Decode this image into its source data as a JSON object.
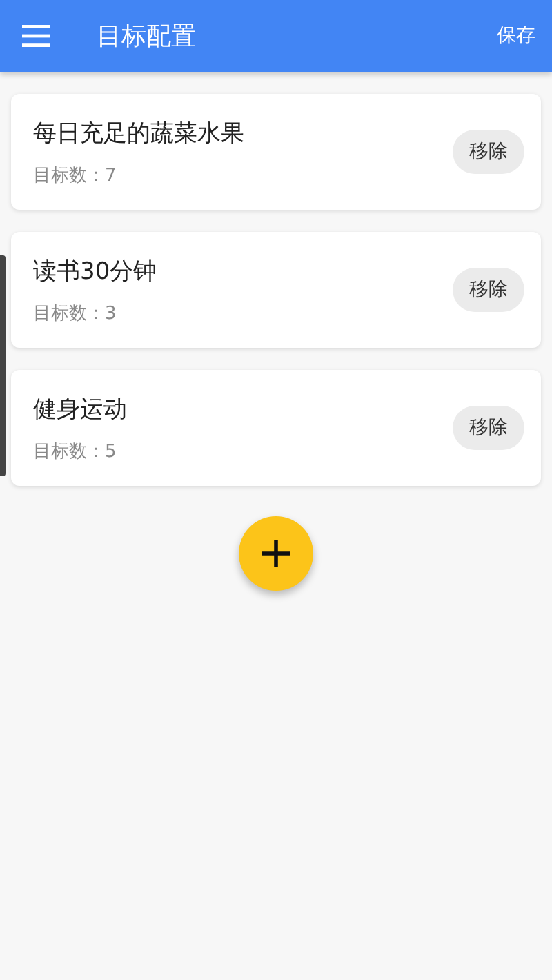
{
  "app_bar": {
    "title": "目标配置",
    "action": "保存"
  },
  "goals": [
    {
      "name": "每日充足的蔬菜水果",
      "count": "目标数：7",
      "remove": "移除"
    },
    {
      "name": "读书30分钟",
      "count": "目标数：3",
      "remove": "移除"
    },
    {
      "name": "健身运动",
      "count": "目标数：5",
      "remove": "移除"
    }
  ]
}
